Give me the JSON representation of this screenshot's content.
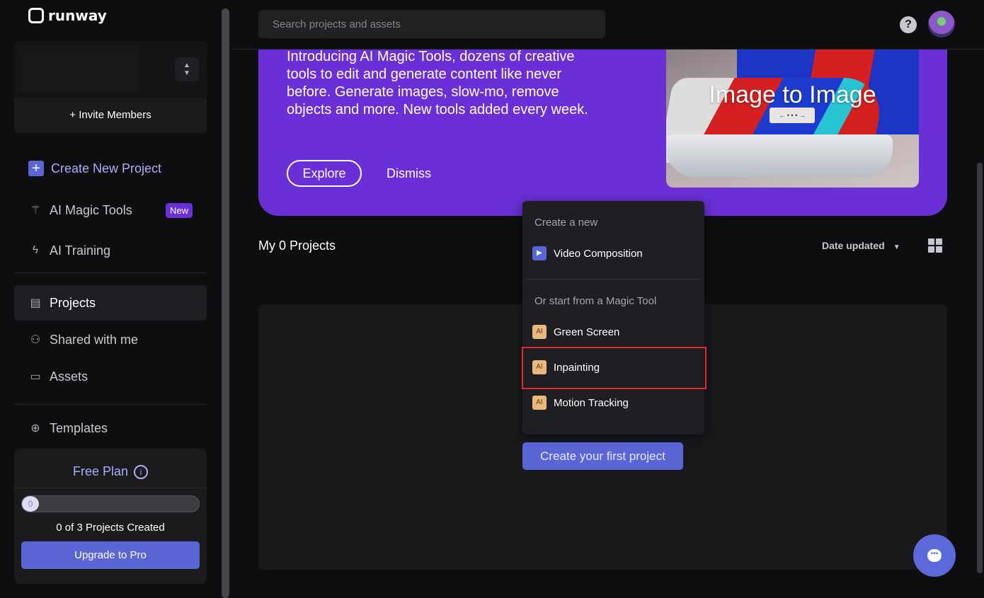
{
  "brand": {
    "name": "runway"
  },
  "sidebar": {
    "invite_label": "+ Invite Members",
    "create_label": "Create New Project",
    "items": [
      {
        "label": "AI Magic Tools",
        "badge": "New",
        "icon": "magic-wand-icon"
      },
      {
        "label": "AI Training",
        "icon": "lightning-icon"
      },
      {
        "label": "Projects",
        "icon": "projects-icon",
        "active": true
      },
      {
        "label": "Shared with me",
        "icon": "users-icon"
      },
      {
        "label": "Assets",
        "icon": "folder-icon"
      },
      {
        "label": "Templates",
        "icon": "globe-icon"
      }
    ],
    "plan": {
      "title": "Free Plan",
      "progress_value": "0",
      "progress_fraction": 0,
      "created_text": "0 of 3 Projects Created",
      "upgrade_label": "Upgrade to Pro"
    }
  },
  "header": {
    "search_placeholder": "Search projects and assets",
    "help": "?"
  },
  "banner": {
    "text": "Introducing AI Magic Tools, dozens of creative tools to edit and generate content like never before. Generate images, slow-mo, remove objects and more. New tools added every week.",
    "explore_label": "Explore",
    "dismiss_label": "Dismiss",
    "image_title": "Image to Image",
    "image_controls": "←  • • •  →"
  },
  "projects": {
    "title": "My 0 Projects",
    "sort_label": "Date updated",
    "create_first_label": "Create your first project"
  },
  "menu": {
    "header_new": "Create a new",
    "video_composition": "Video Composition",
    "header_magic": "Or start from a Magic Tool",
    "ai_badge": "AI",
    "tools": [
      "Green Screen",
      "Inpainting",
      "Motion Tracking"
    ]
  },
  "colors": {
    "accent": "#5b66d6",
    "banner": "#6a2fd6",
    "highlight": "#e02d35"
  }
}
